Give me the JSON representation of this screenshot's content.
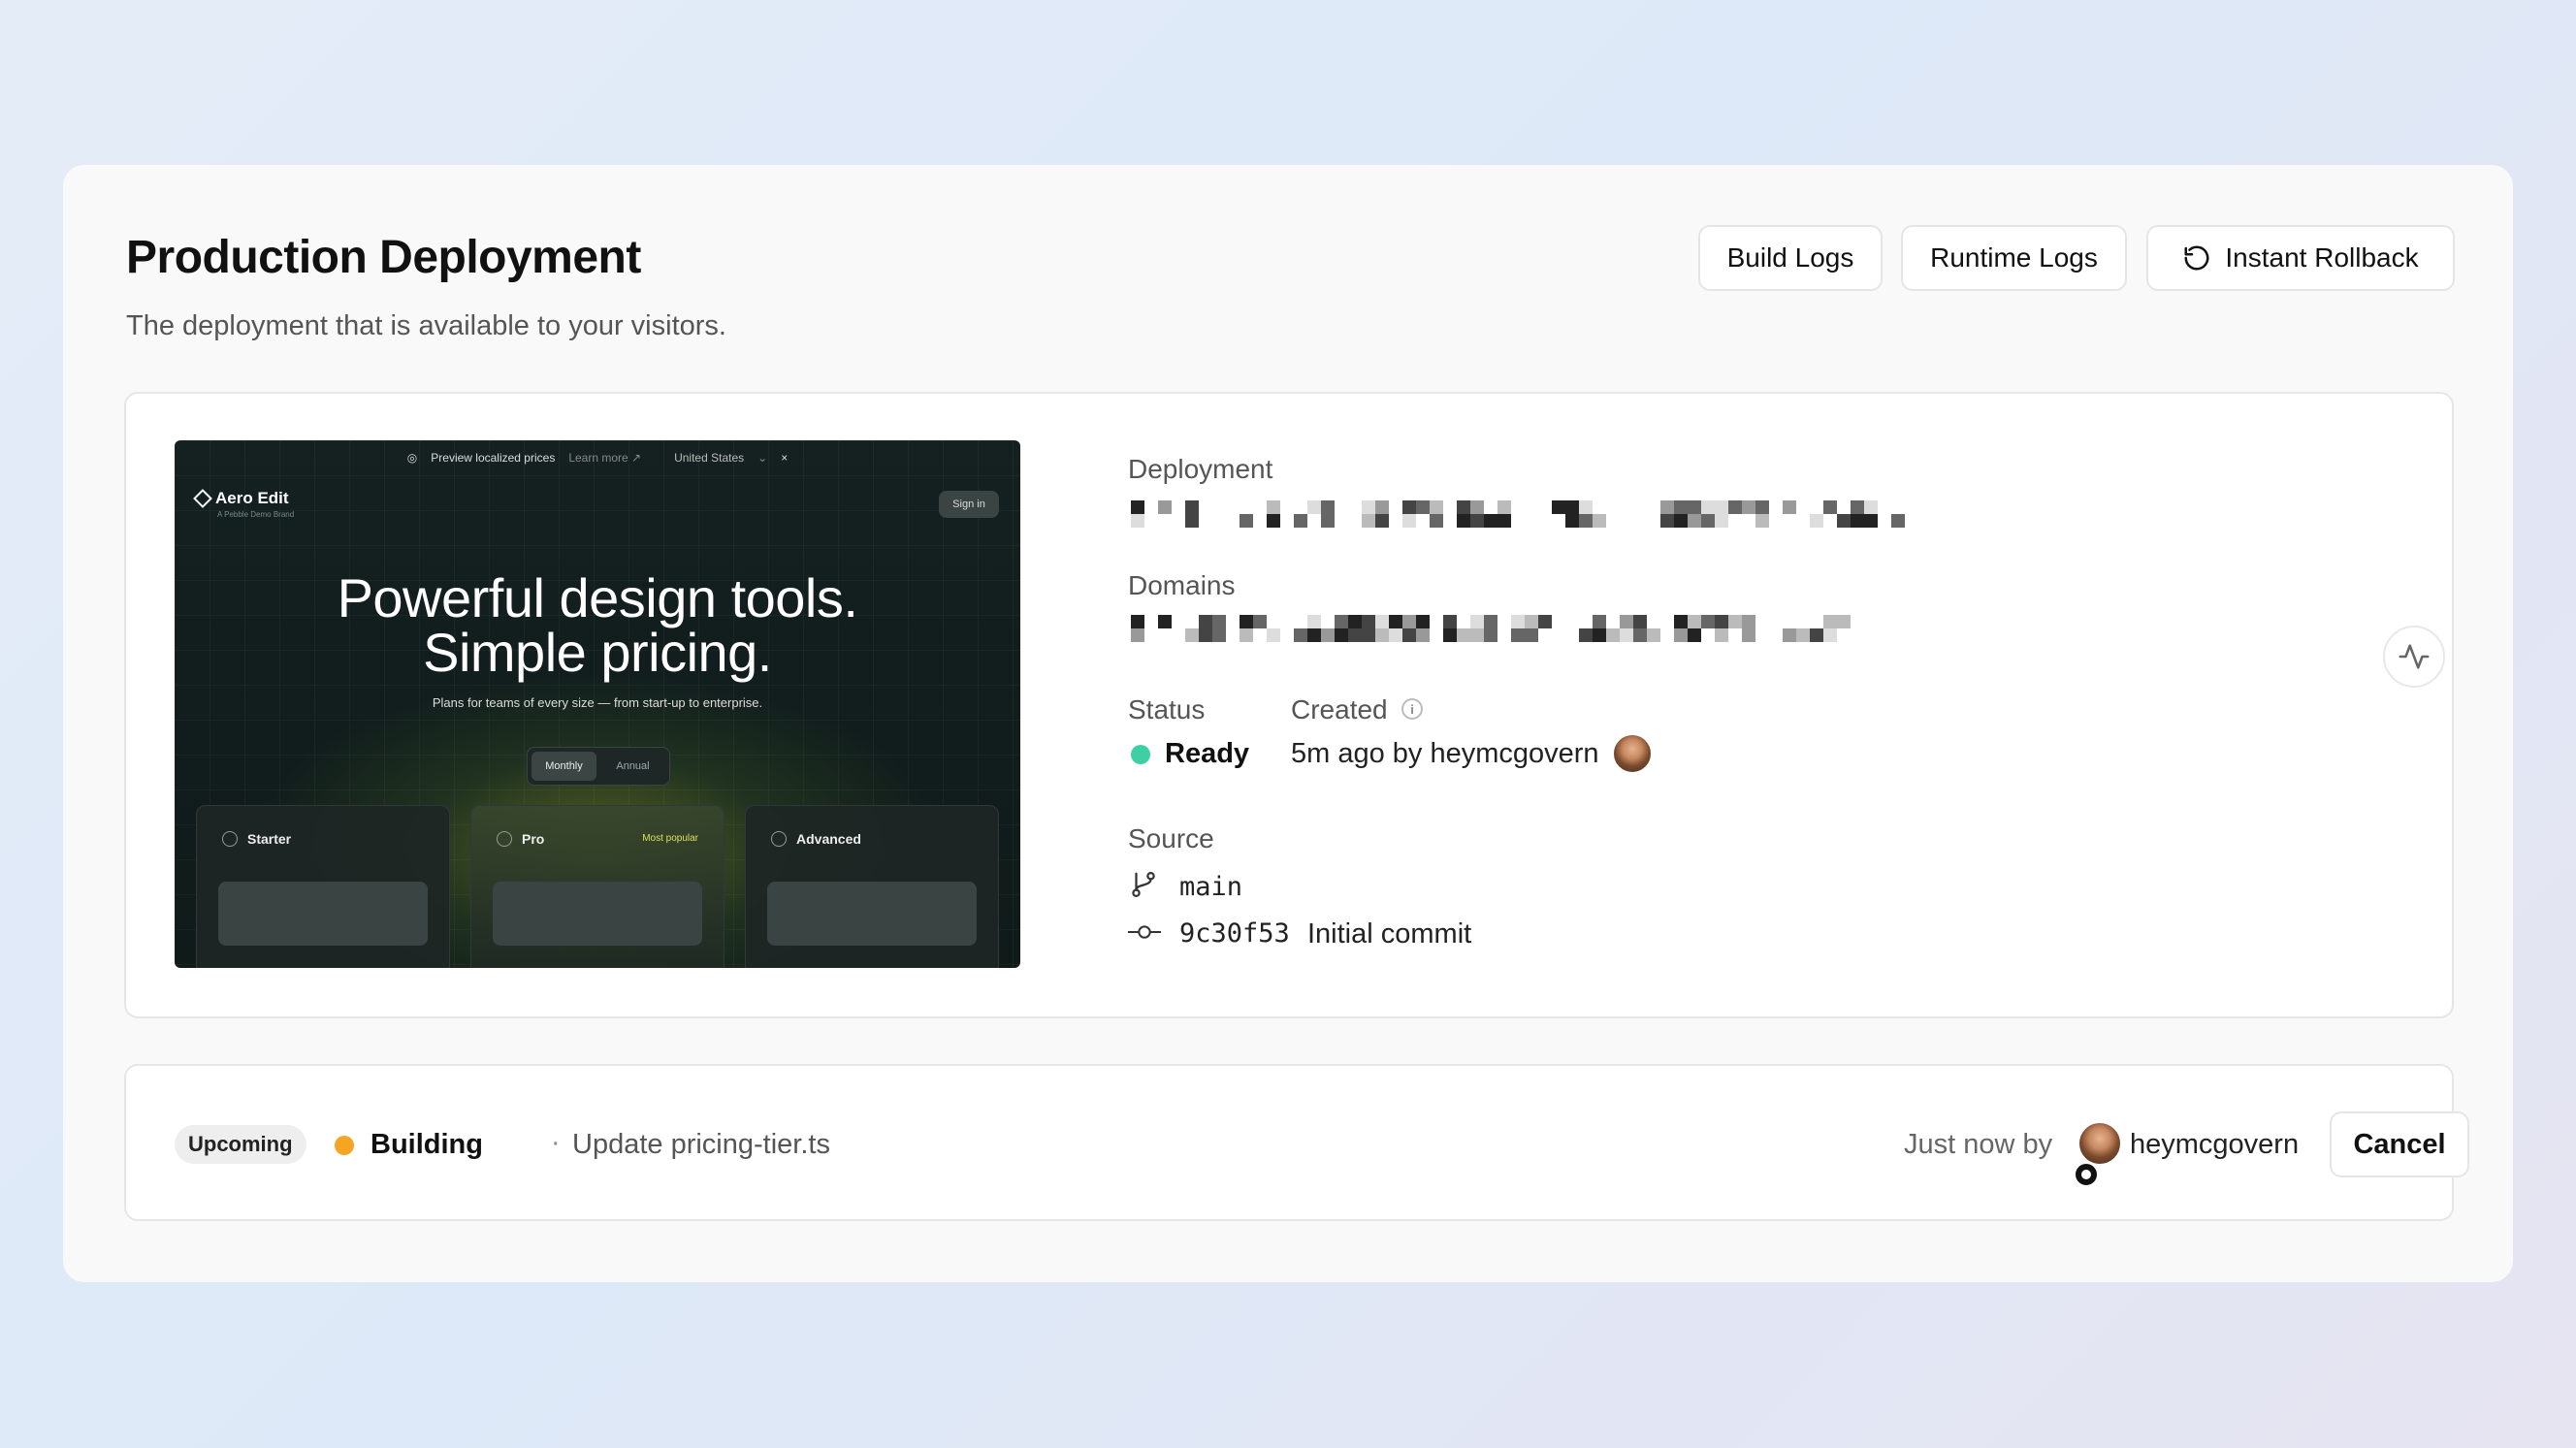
{
  "header": {
    "title": "Production Deployment",
    "subtitle": "The deployment that is available to your visitors.",
    "actions": {
      "build_logs": "Build Logs",
      "runtime_logs": "Runtime Logs",
      "instant_rollback": "Instant Rollback"
    }
  },
  "preview": {
    "topbar_text": "Preview localized prices",
    "topbar_link": "Learn more ↗",
    "topbar_country": "United States",
    "logo": "Aero Edit",
    "tagline": "A Pebble Demo Brand",
    "signin": "Sign in",
    "headline_1": "Powerful design tools.",
    "headline_2": "Simple pricing.",
    "subhead": "Plans for teams of every size — from start-up to enterprise.",
    "toggle_monthly": "Monthly",
    "toggle_annual": "Annual",
    "plans": [
      {
        "name": "Starter"
      },
      {
        "name": "Pro",
        "badge": "Most popular"
      },
      {
        "name": "Advanced"
      }
    ]
  },
  "deployment": {
    "deployment_label": "Deployment",
    "domains_label": "Domains",
    "status_label": "Status",
    "status_value": "Ready",
    "status_color": "#3ecfa5",
    "created_label": "Created",
    "created_value": "5m ago by heymcgovern",
    "source_label": "Source",
    "branch": "main",
    "commit_hash": "9c30f53",
    "commit_message": "Initial commit"
  },
  "upcoming": {
    "badge": "Upcoming",
    "status": "Building",
    "status_color": "#f5a524",
    "separator": "·",
    "message": "Update pricing-tier.ts",
    "time_prefix": "Just now by",
    "user": "heymcgovern",
    "cancel": "Cancel"
  }
}
